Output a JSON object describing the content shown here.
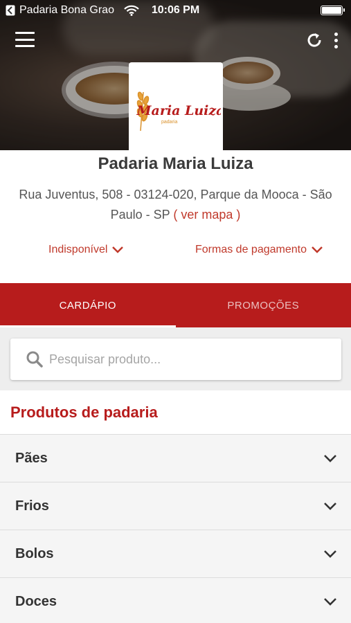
{
  "status_bar": {
    "carrier": "Padaria Bona Grao",
    "time": "10:06 PM",
    "battery_level": 1.0
  },
  "store": {
    "logo_text": "Maria Luiza",
    "logo_subtext": "padaria",
    "name": "Padaria Maria Luiza",
    "address_line": "Rua Juventus, 508 - 03124-020, Parque da Mooca - São Paulo - SP",
    "map_open": "(",
    "map_link": "ver mapa",
    "map_close": ")",
    "availability": "Indisponível",
    "payment_methods": "Formas de pagamento"
  },
  "tabs": [
    {
      "label": "CARDÁPIO",
      "active": true
    },
    {
      "label": "PROMOÇÕES",
      "active": false
    }
  ],
  "search": {
    "placeholder": "Pesquisar produto..."
  },
  "section_title": "Produtos de padaria",
  "categories": [
    {
      "label": "Pães"
    },
    {
      "label": "Frios"
    },
    {
      "label": "Bolos"
    },
    {
      "label": "Doces"
    }
  ],
  "colors": {
    "accent": "#b71c1c",
    "link": "#c0392b"
  }
}
